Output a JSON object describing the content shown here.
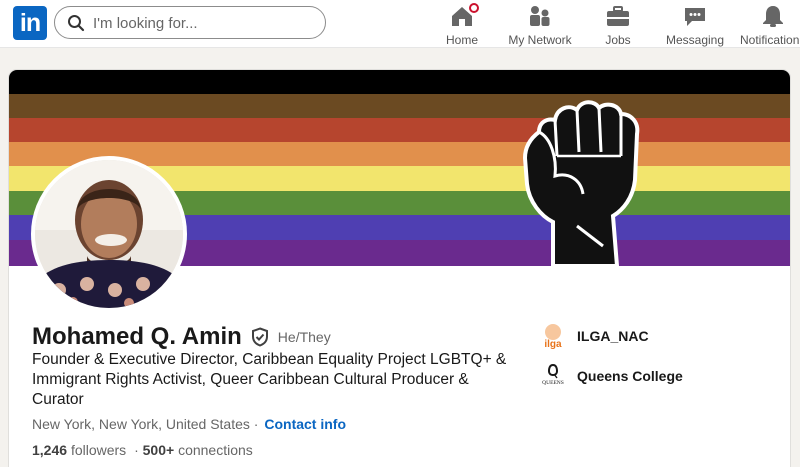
{
  "nav": {
    "logo_text": "in",
    "search_placeholder": "I'm looking for...",
    "items": [
      {
        "label": "Home",
        "icon": "home-icon"
      },
      {
        "label": "My Network",
        "icon": "network-icon"
      },
      {
        "label": "Jobs",
        "icon": "briefcase-icon"
      },
      {
        "label": "Messaging",
        "icon": "messaging-icon"
      },
      {
        "label": "Notification",
        "icon": "bell-icon"
      }
    ]
  },
  "profile": {
    "name": "Mohamed Q. Amin",
    "pronouns": "He/They",
    "headline": "Founder & Executive Director, Caribbean Equality Project LGBTQ+ & Immigrant Rights Activist, Queer Caribbean Cultural Producer & Curator",
    "location": "New York, New York, United States",
    "location_separator": "·",
    "contact_label": "Contact info",
    "followers_count": "1,246",
    "followers_label": "followers",
    "connections_count": "500+",
    "connections_label": "connections",
    "stats_separator": "·"
  },
  "organizations": [
    {
      "name": "ILGA_NAC",
      "logo_text": "ilga",
      "logo_color": "#e8731a"
    },
    {
      "name": "Queens College",
      "logo_text": "QUEENS",
      "logo_color": "#191919"
    }
  ],
  "colors": {
    "brand": "#0a66c2",
    "banner_stripes": [
      "#000000",
      "#6b4a22",
      "#b6452e",
      "#e1904c",
      "#f2e56d",
      "#5a8f3a",
      "#4f3fb2",
      "#6a2a8e"
    ]
  }
}
